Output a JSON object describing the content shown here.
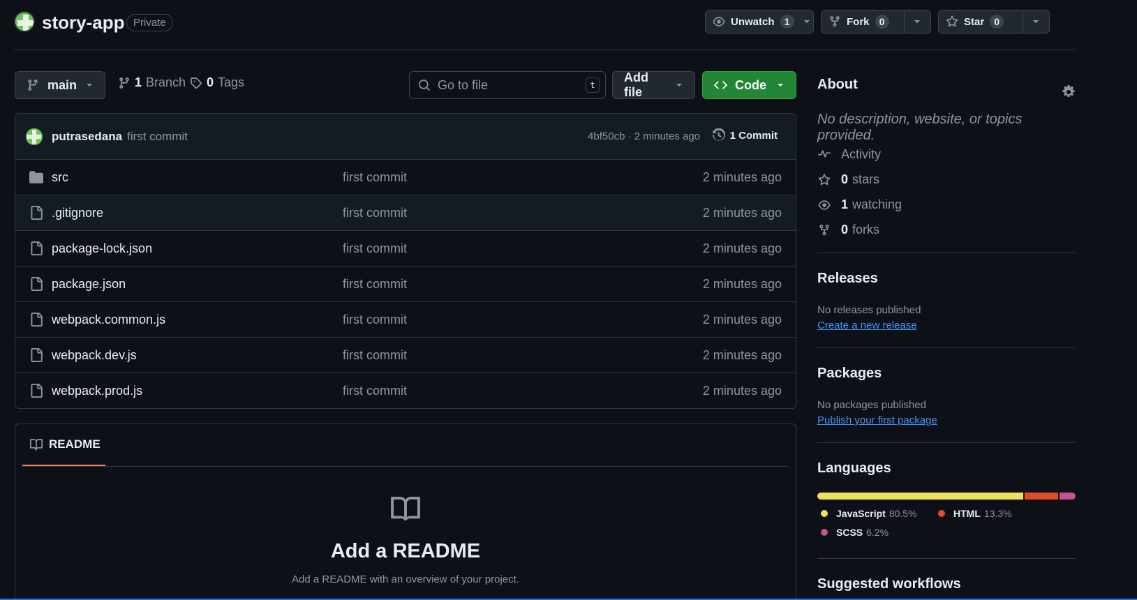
{
  "repo": {
    "name": "story-app",
    "visibility": "Private"
  },
  "header_actions": {
    "unwatch": {
      "label": "Unwatch",
      "count": "1"
    },
    "fork": {
      "label": "Fork",
      "count": "0"
    },
    "star": {
      "label": "Star",
      "count": "0"
    }
  },
  "branch_bar": {
    "branch": "main",
    "branch_count": "1",
    "branch_label": "Branch",
    "tag_count": "0",
    "tag_label": "Tags",
    "search_placeholder": "Go to file",
    "search_shortcut": "t",
    "add_file": "Add file",
    "code": "Code"
  },
  "latest_commit": {
    "author": "putrasedana",
    "message": "first commit",
    "hash_time": "4bf50cb · 2 minutes ago",
    "commit_count": "1 Commit"
  },
  "files": [
    {
      "name": "src",
      "type": "folder",
      "message": "first commit",
      "time": "2 minutes ago"
    },
    {
      "name": ".gitignore",
      "type": "file",
      "message": "first commit",
      "time": "2 minutes ago"
    },
    {
      "name": "package-lock.json",
      "type": "file",
      "message": "first commit",
      "time": "2 minutes ago"
    },
    {
      "name": "package.json",
      "type": "file",
      "message": "first commit",
      "time": "2 minutes ago"
    },
    {
      "name": "webpack.common.js",
      "type": "file",
      "message": "first commit",
      "time": "2 minutes ago"
    },
    {
      "name": "webpack.dev.js",
      "type": "file",
      "message": "first commit",
      "time": "2 minutes ago"
    },
    {
      "name": "webpack.prod.js",
      "type": "file",
      "message": "first commit",
      "time": "2 minutes ago"
    }
  ],
  "readme": {
    "tab": "README",
    "title": "Add a README",
    "subtitle": "Add a README with an overview of your project."
  },
  "about": {
    "title": "About",
    "description": "No description, website, or topics provided.",
    "activity": "Activity",
    "stars_count": "0",
    "stars_label": "stars",
    "watching_count": "1",
    "watching_label": "watching",
    "forks_count": "0",
    "forks_label": "forks"
  },
  "releases": {
    "title": "Releases",
    "empty": "No releases published",
    "link": "Create a new release"
  },
  "packages": {
    "title": "Packages",
    "empty": "No packages published",
    "link": "Publish your first package"
  },
  "languages": {
    "title": "Languages",
    "items": [
      {
        "name": "JavaScript",
        "percent": "80.5%",
        "value": 80.5,
        "color": "#f1e05a"
      },
      {
        "name": "HTML",
        "percent": "13.3%",
        "value": 13.3,
        "color": "#e34c26"
      },
      {
        "name": "SCSS",
        "percent": "6.2%",
        "value": 6.2,
        "color": "#c6538c"
      }
    ]
  },
  "suggested_workflows": {
    "title": "Suggested workflows"
  }
}
